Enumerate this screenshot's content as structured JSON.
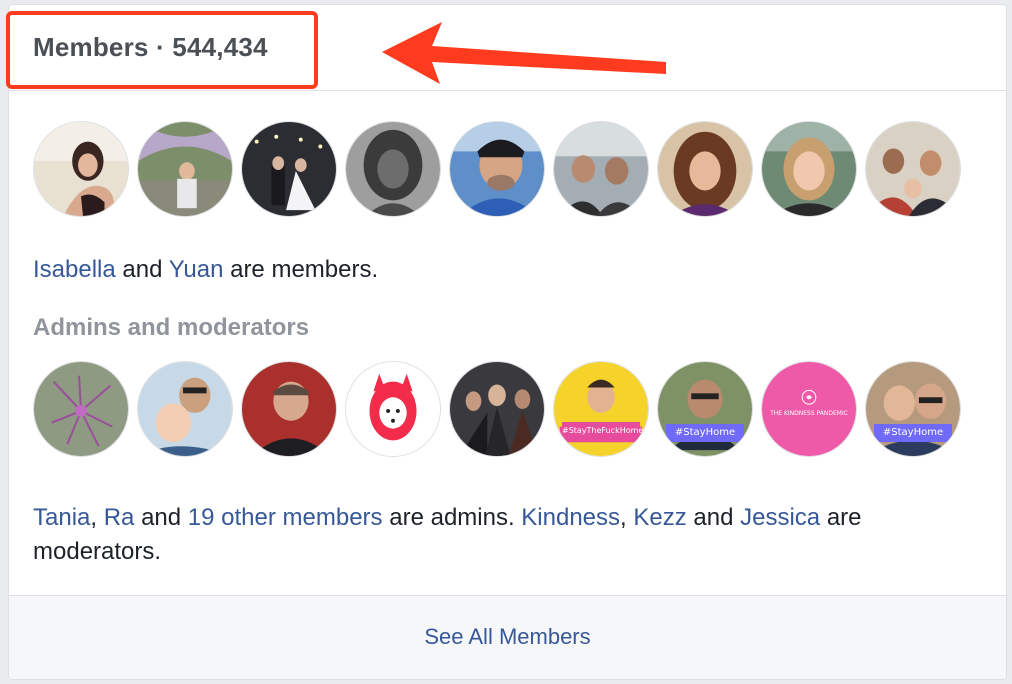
{
  "members_header": {
    "label": "Members",
    "separator": "·",
    "count": "544,434"
  },
  "members_summary": {
    "name1": "Isabella",
    "conj": "and",
    "name2": "Yuan",
    "suffix": "are members."
  },
  "admins_section": {
    "heading": "Admins and moderators"
  },
  "admins_summary": {
    "admin1": "Tania",
    "comma1": ",",
    "admin2": "Ra",
    "and1": "and",
    "others_link": "19 other members",
    "admins_suffix": "are admins.",
    "mod1": "Kindness",
    "comma2": ",",
    "mod2": "Kezz",
    "and2": "and",
    "mod3": "Jessica",
    "mods_suffix": "are moderators."
  },
  "avatar_badges": {
    "stay_home": "#StayHome",
    "stay_home_2": "#StayHome",
    "stay_fhome": "#StayTheFuckHome"
  },
  "kindness_avatar_text": "THE KINDNESS PANDEMIC",
  "footer": {
    "see_all": "See All Members"
  },
  "colors": {
    "link": "#365899",
    "annotation_red": "#ff3b1f",
    "muted_heading": "#90949c"
  }
}
